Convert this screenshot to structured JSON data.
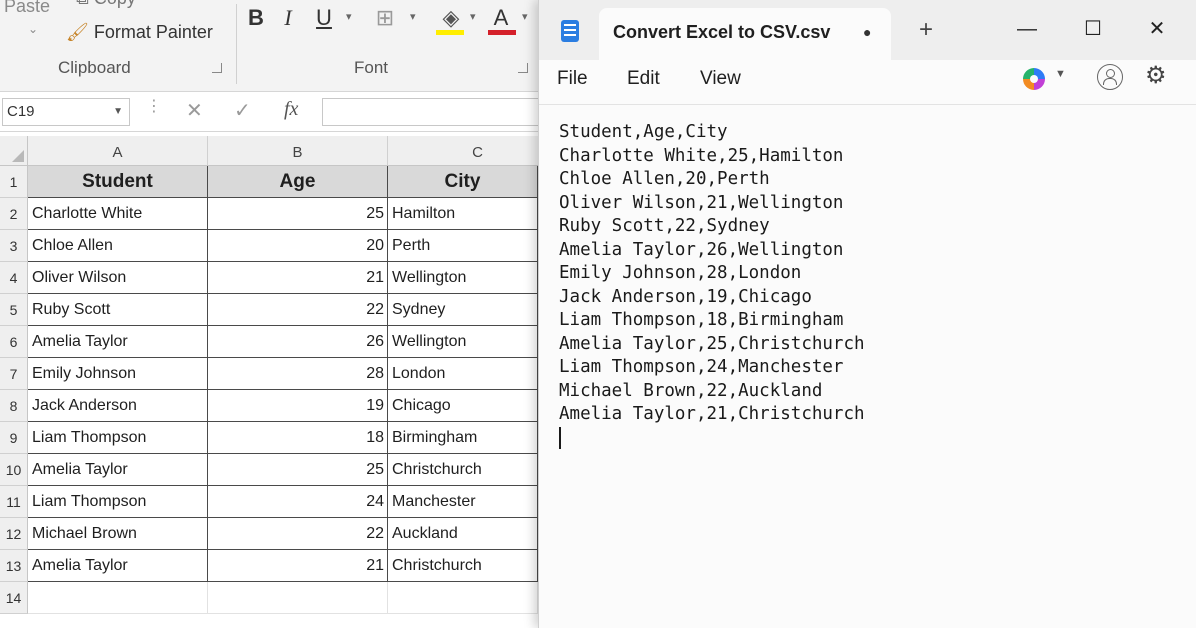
{
  "excel": {
    "ribbon": {
      "paste_label": "Paste",
      "copy_label": "Copy",
      "format_painter_label": "Format Painter",
      "clipboard_group": "Clipboard",
      "font_group": "Font",
      "bold": "B",
      "italic": "I",
      "underline": "U",
      "font_color_glyph": "A"
    },
    "formula_bar": {
      "name_box": "C19",
      "fx_label": "fx"
    },
    "columns": [
      "A",
      "B",
      "C"
    ],
    "row_numbers": [
      "1",
      "2",
      "3",
      "4",
      "5",
      "6",
      "7",
      "8",
      "9",
      "10",
      "11",
      "12",
      "13",
      "14"
    ],
    "header": {
      "student": "Student",
      "age": "Age",
      "city": "City"
    },
    "rows": [
      {
        "student": "Charlotte White",
        "age": "25",
        "city": "Hamilton"
      },
      {
        "student": "Chloe Allen",
        "age": "20",
        "city": "Perth"
      },
      {
        "student": "Oliver Wilson",
        "age": "21",
        "city": "Wellington"
      },
      {
        "student": "Ruby Scott",
        "age": "22",
        "city": "Sydney"
      },
      {
        "student": "Amelia Taylor",
        "age": "26",
        "city": "Wellington"
      },
      {
        "student": "Emily Johnson",
        "age": "28",
        "city": "London"
      },
      {
        "student": "Jack Anderson",
        "age": "19",
        "city": "Chicago"
      },
      {
        "student": "Liam Thompson",
        "age": "18",
        "city": "Birmingham"
      },
      {
        "student": "Amelia Taylor",
        "age": "25",
        "city": "Christchurch"
      },
      {
        "student": "Liam Thompson",
        "age": "24",
        "city": "Manchester"
      },
      {
        "student": "Michael Brown",
        "age": "22",
        "city": "Auckland"
      },
      {
        "student": "Amelia Taylor",
        "age": "21",
        "city": "Christchurch"
      }
    ]
  },
  "notepad": {
    "tab_title": "Convert Excel to CSV.csv",
    "menu": {
      "file": "File",
      "edit": "Edit",
      "view": "View"
    },
    "lines": [
      "Student,Age,City",
      "Charlotte White,25,Hamilton",
      "Chloe Allen,20,Perth",
      "Oliver Wilson,21,Wellington",
      "Ruby Scott,22,Sydney",
      "Amelia Taylor,26,Wellington",
      "Emily Johnson,28,London",
      "Jack Anderson,19,Chicago",
      "Liam Thompson,18,Birmingham",
      "Amelia Taylor,25,Christchurch",
      "Liam Thompson,24,Manchester",
      "Michael Brown,22,Auckland",
      "Amelia Taylor,21,Christchurch"
    ]
  }
}
